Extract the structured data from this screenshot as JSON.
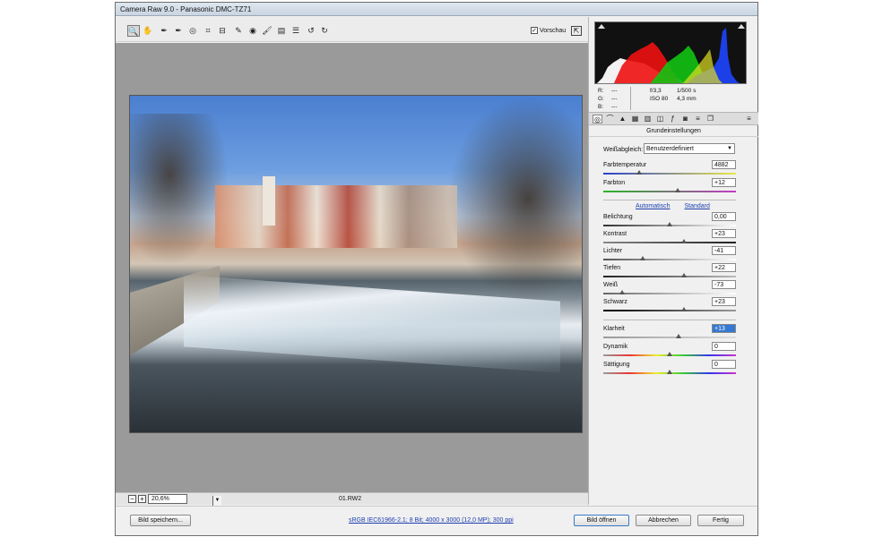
{
  "window": {
    "title": "Camera Raw 9.0 - Panasonic DMC-TZ71"
  },
  "toolbar": {
    "tools": [
      {
        "name": "zoom-tool-icon",
        "glyph": "🔍"
      },
      {
        "name": "hand-tool-icon",
        "glyph": "✋"
      },
      {
        "name": "white-balance-tool-icon",
        "glyph": "✒"
      },
      {
        "name": "color-sampler-tool-icon",
        "glyph": "✒"
      },
      {
        "name": "targeted-adjustment-tool-icon",
        "glyph": "◎"
      },
      {
        "name": "crop-tool-icon",
        "glyph": "⌗"
      },
      {
        "name": "straighten-tool-icon",
        "glyph": "⊟"
      },
      {
        "name": "spot-removal-tool-icon",
        "glyph": "✎"
      },
      {
        "name": "red-eye-tool-icon",
        "glyph": "◉"
      },
      {
        "name": "adjustment-brush-icon",
        "glyph": "🖌"
      },
      {
        "name": "graduated-filter-icon",
        "glyph": "▤"
      },
      {
        "name": "preferences-icon",
        "glyph": "☰"
      },
      {
        "name": "rotate-left-icon",
        "glyph": "↺"
      },
      {
        "name": "rotate-right-icon",
        "glyph": "↻"
      }
    ],
    "preview_label": "Vorschau",
    "preview_checked": "✓"
  },
  "status": {
    "zoom_minus": "−",
    "zoom_plus": "+",
    "zoom_value": "20,6%",
    "zoom_arrow": "▼",
    "filename": "01.RW2"
  },
  "readout": {
    "r_label": "R:",
    "g_label": "G:",
    "b_label": "B:",
    "r_value": "---",
    "g_value": "---",
    "b_value": "---",
    "aperture": "f/3,3",
    "shutter": "1/500 s",
    "iso": "ISO 80",
    "focal": "4,3 mm"
  },
  "panel": {
    "section_title": "Grundeinstellungen",
    "wb_label": "Weißabgleich:",
    "wb_value": "Benutzerdefiniert",
    "auto_label": "Automatisch",
    "standard_label": "Standard"
  },
  "sliders": {
    "farbtemperatur": {
      "label": "Farbtemperatur",
      "value": "4882",
      "position": 0.27
    },
    "farbton": {
      "label": "Farbton",
      "value": "+12",
      "position": 0.56
    },
    "belichtung": {
      "label": "Belichtung",
      "value": "0,00",
      "position": 0.5
    },
    "kontrast": {
      "label": "Kontrast",
      "value": "+23",
      "position": 0.61
    },
    "lichter": {
      "label": "Lichter",
      "value": "-41",
      "position": 0.3
    },
    "tiefen": {
      "label": "Tiefen",
      "value": "+22",
      "position": 0.61
    },
    "weiss": {
      "label": "Weiß",
      "value": "-73",
      "position": 0.14
    },
    "schwarz": {
      "label": "Schwarz",
      "value": "+23",
      "position": 0.61
    },
    "klarheit": {
      "label": "Klarheit",
      "value": "+13",
      "position": 0.57
    },
    "dynamik": {
      "label": "Dynamik",
      "value": "0",
      "position": 0.5
    },
    "saettigung": {
      "label": "Sättigung",
      "value": "0",
      "position": 0.5
    }
  },
  "bottom": {
    "save_image": "Bild speichern...",
    "workflow": "sRGB IEC61966-2.1; 8 Bit; 4000 x 3000 (12,0 MP); 300 ppi",
    "open_image": "Bild öffnen",
    "cancel": "Abbrechen",
    "done": "Fertig"
  }
}
